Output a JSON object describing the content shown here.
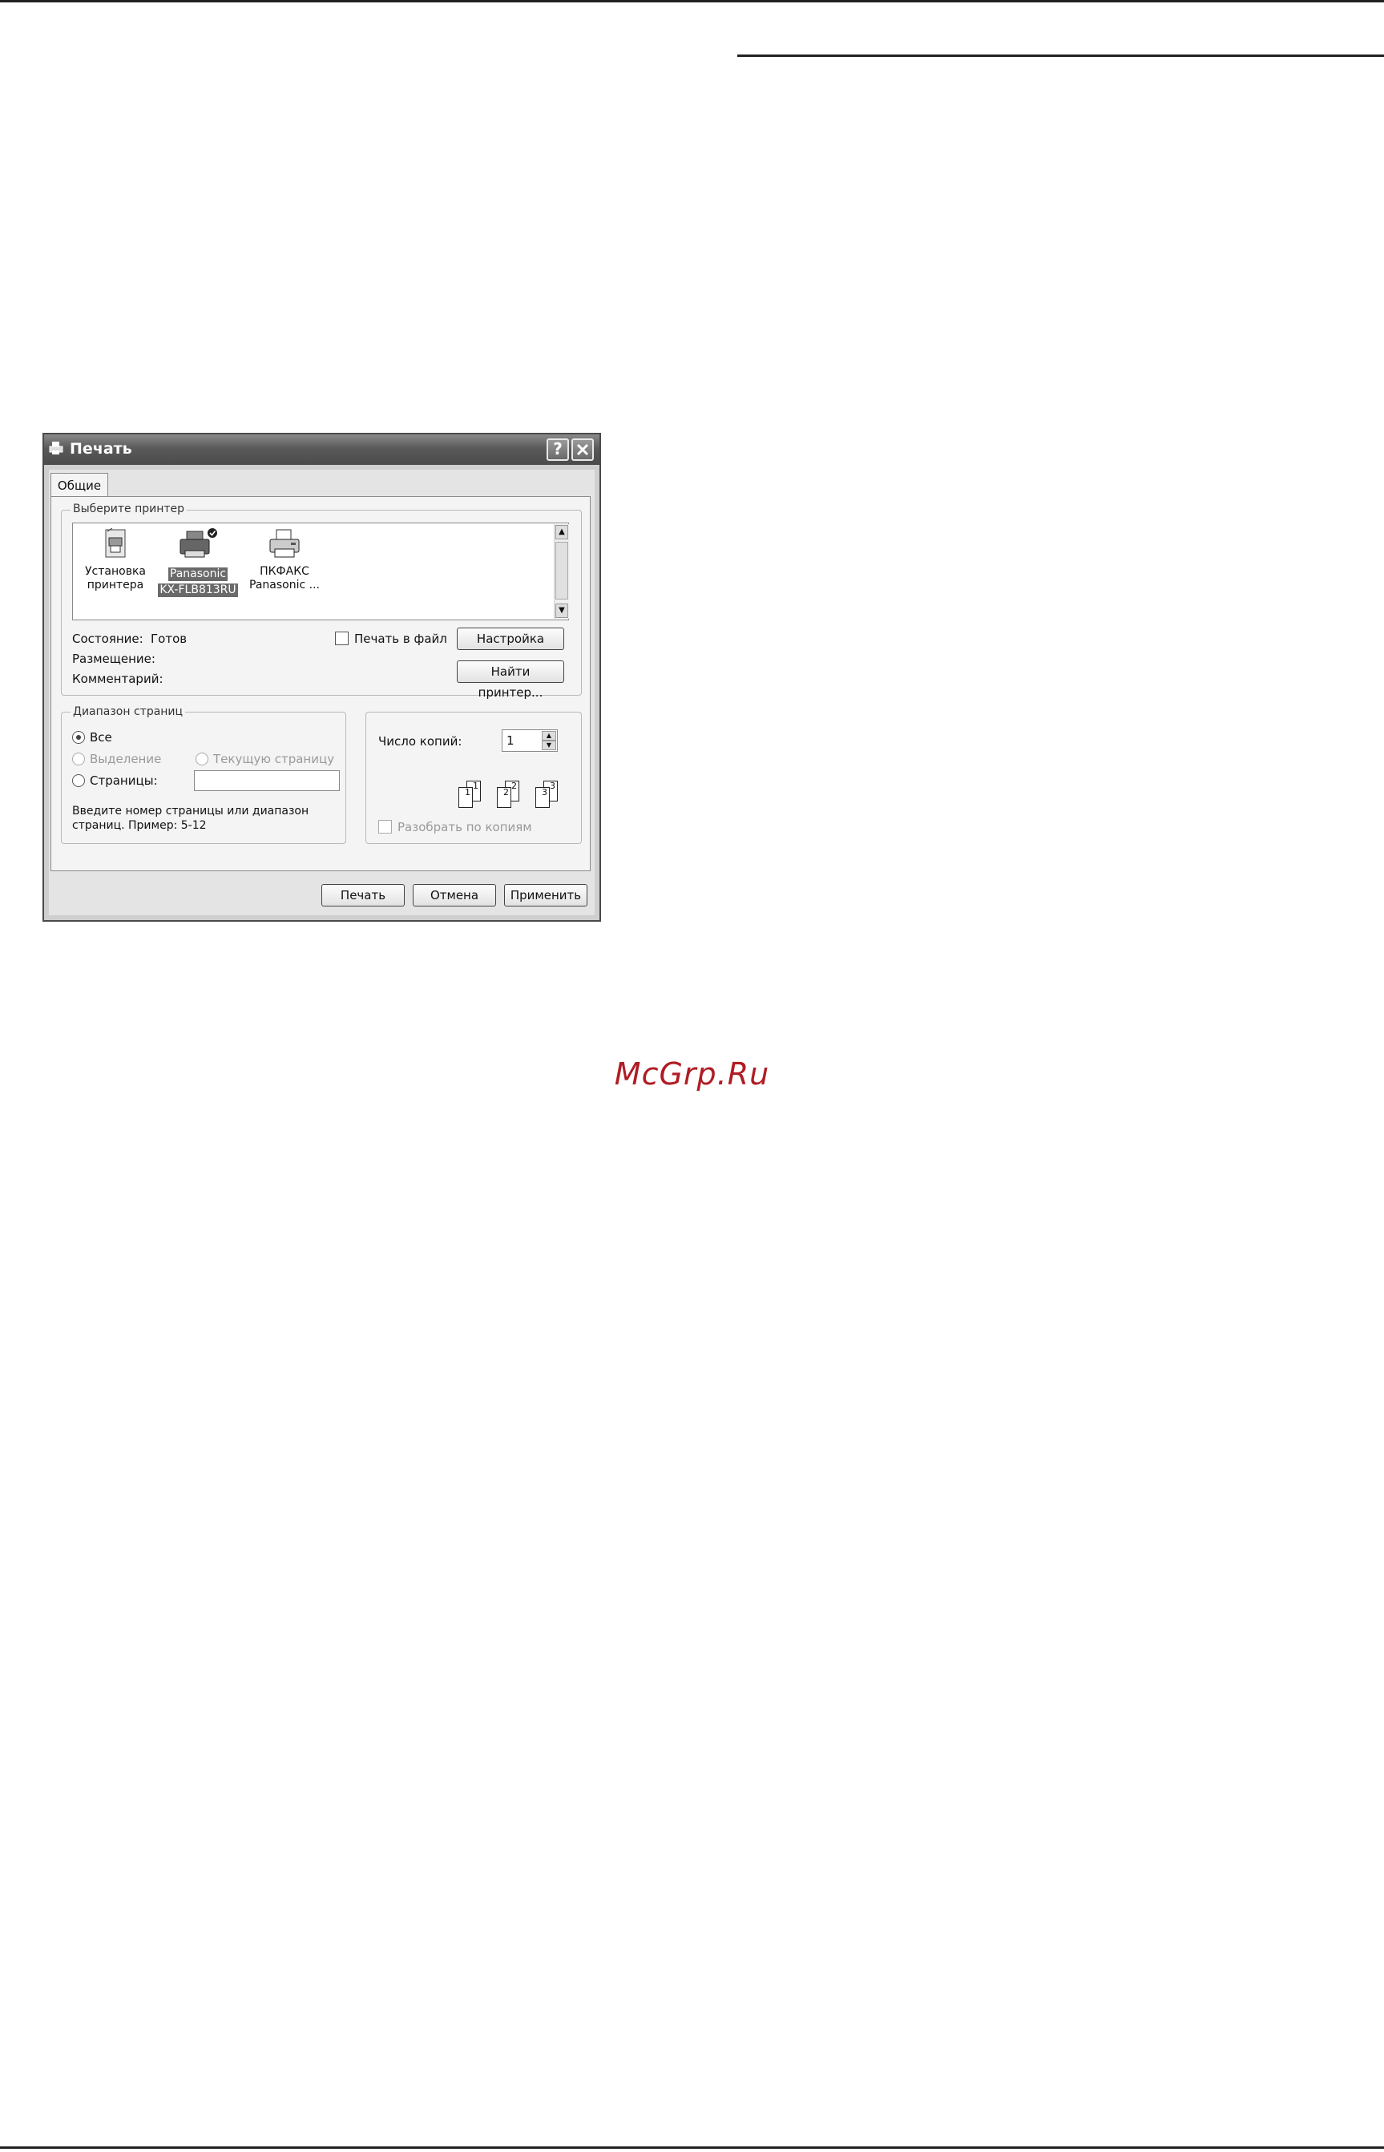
{
  "watermark": "McGrp.Ru",
  "dialog": {
    "title": "Печать",
    "help_button": "?",
    "close_button": "✕",
    "tab_general": "Общие",
    "select_printer": {
      "group_title": "Выберите принтер",
      "printers": [
        {
          "line1": "Установка",
          "line2": "принтера",
          "icon": "add-printer-icon",
          "selected": false
        },
        {
          "line1": "Panasonic",
          "line2": "KX-FLB813RU",
          "icon": "printer-icon",
          "selected": true
        },
        {
          "line1": "ПКФАКС",
          "line2": "Panasonic ...",
          "icon": "fax-printer-icon",
          "selected": false
        }
      ],
      "status_label": "Состояние:",
      "status_value": "Готов",
      "location_label": "Размещение:",
      "comment_label": "Комментарий:",
      "print_to_file_label": "Печать в файл",
      "print_to_file_checked": false,
      "preferences_button": "Настройка",
      "find_printer_button": "Найти принтер..."
    },
    "page_range": {
      "group_title": "Диапазон страниц",
      "all_label": "Все",
      "all_selected": true,
      "selection_label": "Выделение",
      "current_page_label": "Текущую страницу",
      "pages_label": "Страницы:",
      "pages_value": "",
      "hint_line1": "Введите номер страницы или диапазон",
      "hint_line2": "страниц.  Пример: 5-12"
    },
    "copies": {
      "label": "Число копий:",
      "value": "1",
      "collate_label": "Разобрать по копиям",
      "collate_checked": false,
      "collate_pages": [
        "1",
        "1",
        "2",
        "2",
        "3",
        "3"
      ]
    },
    "buttons": {
      "print": "Печать",
      "cancel": "Отмена",
      "apply": "Применить"
    }
  }
}
